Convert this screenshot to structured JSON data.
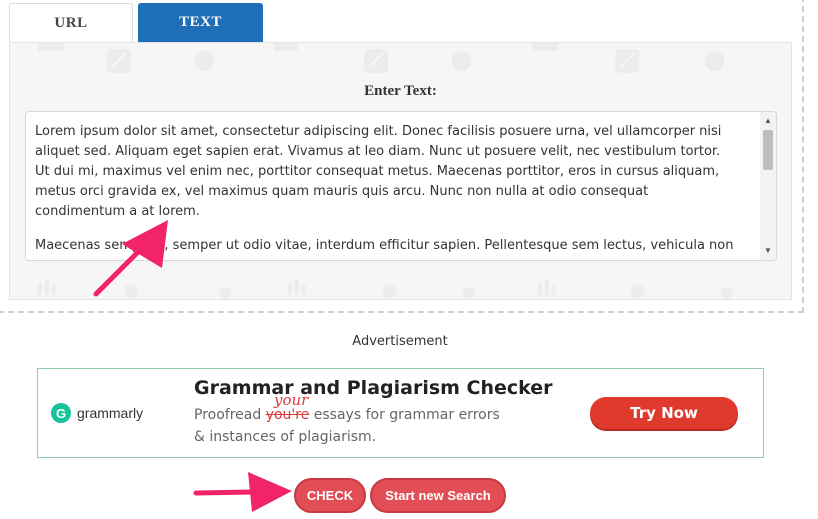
{
  "tabs": {
    "url": "URL",
    "text": "TEXT",
    "active": "TEXT"
  },
  "panel": {
    "label": "Enter Text:"
  },
  "textbox": {
    "paragraphs": [
      "Lorem ipsum dolor sit amet, consectetur adipiscing elit. Donec facilisis posuere urna, vel ullamcorper nisi aliquet sed. Aliquam eget sapien erat. Vivamus at leo diam. Nunc ut posuere velit, nec vestibulum tortor. Ut dui mi, maximus vel enim nec, porttitor consequat metus. Maecenas porttitor, eros in cursus aliquam, metus orci gravida ex, vel maximus quam mauris quis arcu. Nunc non nulla at odio consequat condimentum a at lorem.",
      "Maecenas semper s, semper ut odio vitae, interdum efficitur sapien. Pellentesque sem lectus, vehicula non"
    ]
  },
  "ad": {
    "label": "Advertisement",
    "logo_letter": "G",
    "logo_text": "grammarly",
    "headline": "Grammar and Plagiarism Checker",
    "line1_before": "Proofread ",
    "line1_struck": "you're",
    "line1_inserted": "your",
    "line1_after": " essays for grammar errors",
    "line2": "& instances of plagiarism.",
    "cta": "Try Now"
  },
  "actions": {
    "check": "CHECK",
    "new_search": "Start new Search"
  },
  "colors": {
    "tab_active": "#1f6fb8",
    "button": "#e14e55",
    "ad_cta": "#e03a2e",
    "arrow": "#f0236b",
    "grammarly": "#15c39a"
  }
}
